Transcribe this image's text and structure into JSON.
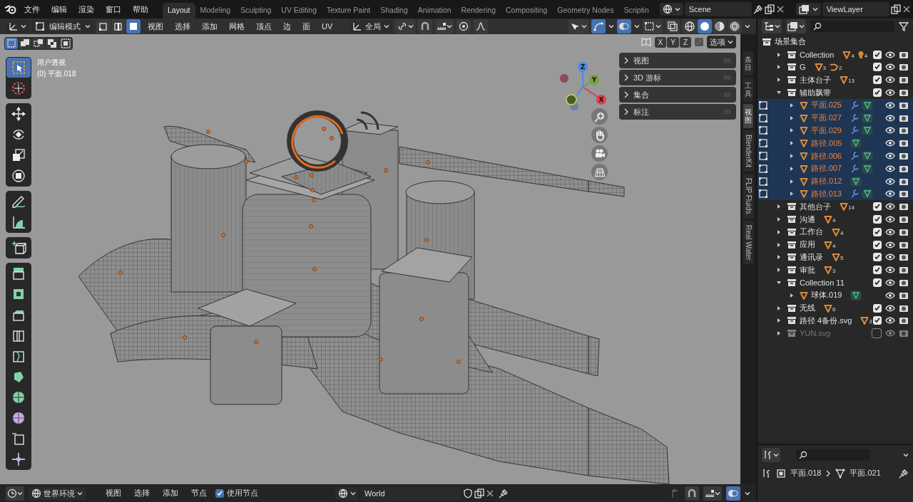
{
  "menu_bar": {
    "items": [
      "文件",
      "编辑",
      "渲染",
      "窗口",
      "帮助"
    ]
  },
  "workspace_tabs": [
    {
      "label": "Layout",
      "selected": true
    },
    {
      "label": "Modeling",
      "selected": false
    },
    {
      "label": "Sculpting",
      "selected": false
    },
    {
      "label": "UV Editing",
      "selected": false
    },
    {
      "label": "Texture Paint",
      "selected": false
    },
    {
      "label": "Shading",
      "selected": false
    },
    {
      "label": "Animation",
      "selected": false
    },
    {
      "label": "Rendering",
      "selected": false
    },
    {
      "label": "Compositing",
      "selected": false
    },
    {
      "label": "Geometry Nodes",
      "selected": false
    },
    {
      "label": "Scriptin",
      "selected": false
    }
  ],
  "scene_field": {
    "value": "Scene"
  },
  "view_layer_field": {
    "value": "ViewLayer"
  },
  "viewport_header": {
    "mode": "编辑模式",
    "select_modes": [
      {
        "kind": "vertex",
        "selected": false
      },
      {
        "kind": "edge",
        "selected": false
      },
      {
        "kind": "face",
        "selected": true
      }
    ],
    "menus": [
      "视图",
      "选择",
      "添加",
      "网格",
      "顶点",
      "边",
      "面",
      "UV"
    ],
    "orientation": "全局",
    "gizmos": true,
    "overlays": true,
    "shading_modes": [
      {
        "kind": "wireframe",
        "selected": false
      },
      {
        "kind": "solid",
        "selected": true
      },
      {
        "kind": "material",
        "selected": false
      },
      {
        "kind": "rendered",
        "selected": false
      }
    ]
  },
  "selection_modes": [
    {
      "selected": true
    },
    {
      "selected": false
    },
    {
      "selected": false
    },
    {
      "selected": false
    },
    {
      "selected": false
    }
  ],
  "mirror_axes": [
    {
      "label": "X",
      "selected": false
    },
    {
      "label": "Y",
      "selected": false
    },
    {
      "label": "Z",
      "selected": false
    }
  ],
  "options_menu": "选项",
  "viewport": {
    "view_name": "用户透视",
    "object_label": "(0) 平面.018"
  },
  "toolbar": {
    "groups": [
      [
        {
          "kind": "select",
          "selected": true
        },
        {
          "kind": "cursor",
          "selected": false
        }
      ],
      [
        {
          "kind": "move",
          "selected": false
        },
        {
          "kind": "rotate",
          "selected": false
        },
        {
          "kind": "scale",
          "selected": false
        },
        {
          "kind": "transform",
          "selected": false
        }
      ],
      [
        {
          "kind": "annotate",
          "selected": false
        },
        {
          "kind": "measure",
          "selected": false
        }
      ],
      [
        {
          "kind": "add_cube",
          "selected": false
        }
      ],
      [
        {
          "kind": "extrude",
          "selected": false
        },
        {
          "kind": "inset",
          "selected": false
        },
        {
          "kind": "bevel",
          "selected": false
        },
        {
          "kind": "loop_cut",
          "selected": false
        },
        {
          "kind": "knife",
          "selected": false
        },
        {
          "kind": "poly_build",
          "selected": false
        },
        {
          "kind": "spin",
          "selected": false
        },
        {
          "kind": "smooth",
          "selected": false
        },
        {
          "kind": "edge_slide",
          "selected": false
        },
        {
          "kind": "shrink",
          "selected": false
        }
      ]
    ]
  },
  "navigation_gizmo": {
    "axes": [
      "Z",
      "Y",
      "X"
    ]
  },
  "sidebar": {
    "panels": [
      {
        "label": "视图",
        "expanded": false
      },
      {
        "label": "3D 游标",
        "expanded": false
      },
      {
        "label": "集合",
        "expanded": false
      },
      {
        "label": "标注",
        "expanded": false
      }
    ],
    "tabs": [
      {
        "label": "条目",
        "kind": "cjk",
        "selected": false
      },
      {
        "label": "工具",
        "kind": "cjk",
        "selected": false
      },
      {
        "label": "视图",
        "kind": "cjk",
        "selected": true
      },
      {
        "label": "BlenderKit",
        "kind": "latin",
        "selected": false
      },
      {
        "label": "FLIP Fluids",
        "kind": "latin",
        "selected": false
      },
      {
        "label": "Real Water",
        "kind": "latin",
        "selected": false
      }
    ]
  },
  "outliner": {
    "root": "场景集合",
    "items": [
      {
        "name": "Collection",
        "kind": "collection",
        "selected": false,
        "expanded": false,
        "checked": true,
        "disabled": false,
        "badges": [
          {
            "kind": "mesh",
            "count": "4"
          },
          {
            "kind": "light",
            "count": "4"
          }
        ]
      },
      {
        "name": "G",
        "kind": "collection",
        "selected": false,
        "expanded": false,
        "checked": true,
        "disabled": false,
        "badges": [
          {
            "kind": "mesh",
            "count": "3"
          },
          {
            "kind": "curve",
            "count": "2"
          }
        ]
      },
      {
        "name": "主体台子",
        "kind": "collection",
        "selected": false,
        "expanded": false,
        "checked": true,
        "disabled": false,
        "badges": [
          {
            "kind": "mesh",
            "count": "13"
          }
        ]
      },
      {
        "name": "辅助飘带",
        "kind": "collection",
        "selected": false,
        "expanded": true,
        "checked": true,
        "disabled": false,
        "children": [
          {
            "name": "平面.025",
            "kind": "object",
            "selected": true,
            "badges": [
              {
                "kind": "modifier"
              },
              {
                "kind": "data"
              }
            ]
          },
          {
            "name": "平面.027",
            "kind": "object",
            "selected": true,
            "badges": [
              {
                "kind": "modifier"
              },
              {
                "kind": "data"
              }
            ]
          },
          {
            "name": "平面.029",
            "kind": "object",
            "selected": true,
            "badges": [
              {
                "kind": "modifier"
              },
              {
                "kind": "data"
              }
            ]
          },
          {
            "name": "路径.005",
            "kind": "object",
            "selected": true,
            "badges": [
              {
                "kind": "data"
              }
            ]
          },
          {
            "name": "路径.006",
            "kind": "object",
            "selected": true,
            "badges": [
              {
                "kind": "modifier"
              },
              {
                "kind": "data"
              }
            ]
          },
          {
            "name": "路径.007",
            "kind": "object",
            "selected": true,
            "badges": [
              {
                "kind": "modifier"
              },
              {
                "kind": "data"
              }
            ]
          },
          {
            "name": "路径.012",
            "kind": "object",
            "selected": true,
            "badges": [
              {
                "kind": "data"
              }
            ]
          },
          {
            "name": "路径.013",
            "kind": "object",
            "selected": true,
            "badges": [
              {
                "kind": "modifier"
              },
              {
                "kind": "data"
              }
            ]
          }
        ]
      },
      {
        "name": "其他台子",
        "kind": "collection",
        "selected": false,
        "expanded": false,
        "checked": true,
        "disabled": false,
        "badges": [
          {
            "kind": "mesh",
            "count": "14"
          }
        ]
      },
      {
        "name": "沟通",
        "kind": "collection",
        "selected": false,
        "expanded": false,
        "checked": true,
        "disabled": false,
        "badges": [
          {
            "kind": "mesh",
            "count": "4"
          }
        ]
      },
      {
        "name": "工作台",
        "kind": "collection",
        "selected": false,
        "expanded": false,
        "checked": true,
        "disabled": false,
        "badges": [
          {
            "kind": "mesh",
            "count": "4"
          }
        ]
      },
      {
        "name": "应用",
        "kind": "collection",
        "selected": false,
        "expanded": false,
        "checked": true,
        "disabled": false,
        "badges": [
          {
            "kind": "mesh",
            "count": "4"
          }
        ]
      },
      {
        "name": "通讯录",
        "kind": "collection",
        "selected": false,
        "expanded": false,
        "checked": true,
        "disabled": false,
        "badges": [
          {
            "kind": "mesh",
            "count": "5"
          }
        ]
      },
      {
        "name": "审批",
        "kind": "collection",
        "selected": false,
        "expanded": false,
        "checked": true,
        "disabled": false,
        "badges": [
          {
            "kind": "mesh",
            "count": "3"
          }
        ]
      },
      {
        "name": "Collection 11",
        "kind": "collection",
        "selected": false,
        "expanded": true,
        "checked": true,
        "disabled": false,
        "children": [
          {
            "name": "球体.019",
            "kind": "object",
            "selected": false,
            "badges": [
              {
                "kind": "data"
              }
            ]
          }
        ]
      },
      {
        "name": "无线",
        "kind": "collection",
        "selected": false,
        "expanded": false,
        "checked": true,
        "disabled": false,
        "badges": [
          {
            "kind": "mesh",
            "count": "6"
          }
        ]
      },
      {
        "name": "路径 4备份.svg",
        "kind": "collection",
        "selected": false,
        "expanded": false,
        "checked": true,
        "disabled": false,
        "badges": [
          {
            "kind": "mesh",
            "count": "3"
          }
        ]
      },
      {
        "name": "YUN.svg",
        "kind": "collection",
        "selected": false,
        "expanded": false,
        "checked": false,
        "disabled": true
      }
    ]
  },
  "node_header": {
    "editor": "世界环境",
    "menus": [
      "视图",
      "选择",
      "添加",
      "节点"
    ],
    "use_nodes": {
      "label": "使用节点",
      "checked": true
    },
    "world": "World"
  },
  "properties": {
    "breadcrumb": [
      "平面.018",
      "平面.021"
    ]
  }
}
